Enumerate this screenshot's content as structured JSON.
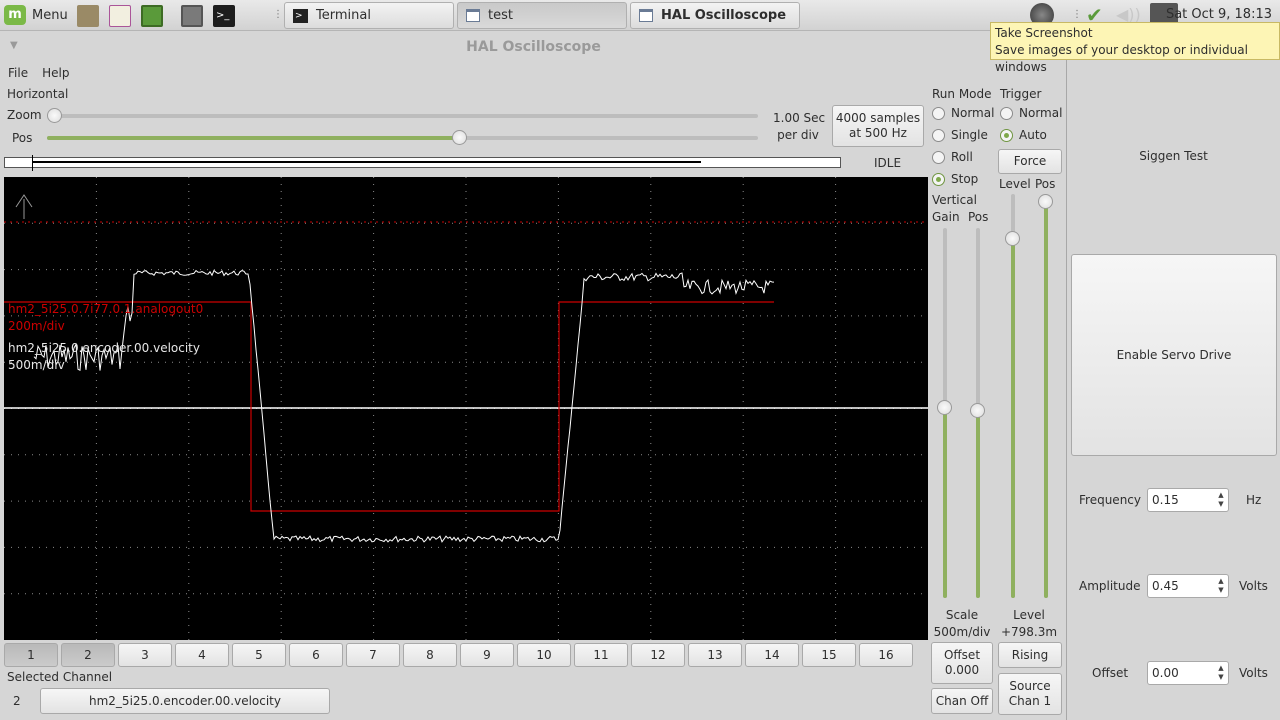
{
  "taskbar": {
    "menu_label": "Menu",
    "tasks": [
      {
        "label": "Terminal"
      },
      {
        "label": "test"
      },
      {
        "label": "HAL Oscilloscope"
      }
    ],
    "clock": "Sat Oct  9, 18:13"
  },
  "tooltip": {
    "title": "Take Screenshot",
    "text": "Save images of your desktop or individual windows"
  },
  "window": {
    "title": "HAL Oscilloscope",
    "menu": [
      "File",
      "Help"
    ]
  },
  "horizontal": {
    "section_label": "Horizontal",
    "zoom_label": "Zoom",
    "pos_label": "Pos",
    "zoom_value": 0.0,
    "pos_value": 0.5,
    "sec_per_div_line1": "1.00 Sec",
    "sec_per_div_line2": "per div",
    "samples_line1": "4000 samples",
    "samples_line2": "at 500 Hz",
    "state": "IDLE"
  },
  "run_mode": {
    "label": "Run Mode",
    "options": [
      "Normal",
      "Single",
      "Roll",
      "Stop"
    ],
    "selected": "Stop"
  },
  "trigger": {
    "label": "Trigger",
    "options": [
      "Normal",
      "Auto"
    ],
    "selected": "Auto",
    "force_label": "Force",
    "level_label": "Level",
    "pos_label": "Pos",
    "level_readout_label": "Level",
    "level_readout_value": "+798.3m",
    "rising_label": "Rising",
    "source_line1": "Source",
    "source_line2": "Chan  1"
  },
  "vertical": {
    "label": "Vertical",
    "gain_label": "Gain",
    "pos_label": "Pos",
    "scale_label": "Scale",
    "scale_value": "500m/div",
    "offset_line1": "Offset",
    "offset_line2": "0.000",
    "chan_off_label": "Chan Off"
  },
  "scope": {
    "traces": [
      {
        "name": "hm2_5i25.0.7i77.0.1.analogout0",
        "scale": "200m/div",
        "color": "#cc0000"
      },
      {
        "name": "hm2_5i25.0.encoder.00.velocity",
        "scale": "500m/div",
        "color": "#ffffff"
      }
    ]
  },
  "channels": [
    "1",
    "2",
    "3",
    "4",
    "5",
    "6",
    "7",
    "8",
    "9",
    "10",
    "11",
    "12",
    "13",
    "14",
    "15",
    "16"
  ],
  "active_channels": [
    "1",
    "2"
  ],
  "selected_channel": {
    "label": "Selected Channel",
    "number": "2",
    "name": "hm2_5i25.0.encoder.00.velocity"
  },
  "siggen": {
    "title": "Siggen Test",
    "enable_label": "Enable Servo Drive",
    "frequency_label": "Frequency",
    "frequency_value": "0.15",
    "frequency_unit": "Hz",
    "amplitude_label": "Amplitude",
    "amplitude_value": "0.45",
    "amplitude_unit": "Volts",
    "offset_label": "Offset",
    "offset_value": "0.00",
    "offset_unit": "Volts"
  }
}
